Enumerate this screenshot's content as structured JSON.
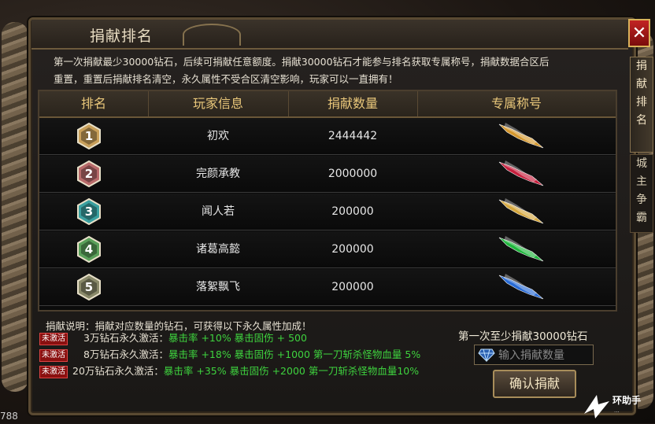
{
  "window": {
    "title": "捐献排名",
    "close_glyph": "✕"
  },
  "intro": {
    "line1": "第一次捐献最少30000钻石，后续可捐献任意额度。捐献30000钻石才能参与排名获取专属称号，捐献数据合区后",
    "line2": "重置，重置后捐献排名清空，永久属性不受合区清空影响，玩家可以一直拥有！"
  },
  "table": {
    "headers": {
      "rank": "排名",
      "player": "玩家信息",
      "amount": "捐献数量",
      "title": "专属称号"
    },
    "rows": [
      {
        "rank": "1",
        "player": "初欢",
        "amount": "2444442",
        "badge_color": "#c9a05a",
        "title_color": "#e0a030",
        "title_icon": "title-wing-gold-blue-icon"
      },
      {
        "rank": "2",
        "player": "完颜承教",
        "amount": "2000000",
        "badge_color": "#b86a6a",
        "title_color": "#d02040",
        "title_icon": "title-wing-red-icon"
      },
      {
        "rank": "3",
        "player": "闻人若",
        "amount": "200000",
        "badge_color": "#3aa0a0",
        "title_color": "#e0b040",
        "title_icon": "title-wing-gold-icon"
      },
      {
        "rank": "4",
        "player": "诸葛高懿",
        "amount": "200000",
        "badge_color": "#5aa05a",
        "title_color": "#20c040",
        "title_icon": "title-wing-green-icon"
      },
      {
        "rank": "5",
        "player": "落絮飘飞",
        "amount": "200000",
        "badge_color": "#8a8a6a",
        "title_color": "#2a70e0",
        "title_icon": "title-wing-blue-icon"
      }
    ]
  },
  "bonus": {
    "description": "捐献说明：捐献对应数量的钻石，可获得以下永久属性加成！",
    "tiers": [
      {
        "tag": "未激活",
        "label": "3万钻石永久激活：",
        "effect": "暴击率 +10% 暴击固伤 +  500"
      },
      {
        "tag": "未激活",
        "label": "8万钻石永久激活：",
        "effect": "暴击率 +18% 暴击固伤 +1000  第一刀斩杀怪物血量 5%"
      },
      {
        "tag": "未激活",
        "label": "20万钻石永久激活：",
        "effect": "暴击率 +35% 暴击固伤 +2000  第一刀斩杀怪物血量10%"
      }
    ]
  },
  "donate": {
    "min_label": "第一次至少捐献30000钻石",
    "placeholder": "输入捐献数量",
    "confirm_label": "确认捐献"
  },
  "side_tabs": [
    {
      "label": "捐献排名"
    },
    {
      "label": "城主争霸"
    }
  ],
  "watermark": {
    "text": "环助手",
    "sub": "..."
  },
  "corner_number": "788",
  "colors": {
    "accent_gold": "#e9c77a",
    "effect_green": "#3ed23e",
    "tag_red": "#8a1010"
  }
}
